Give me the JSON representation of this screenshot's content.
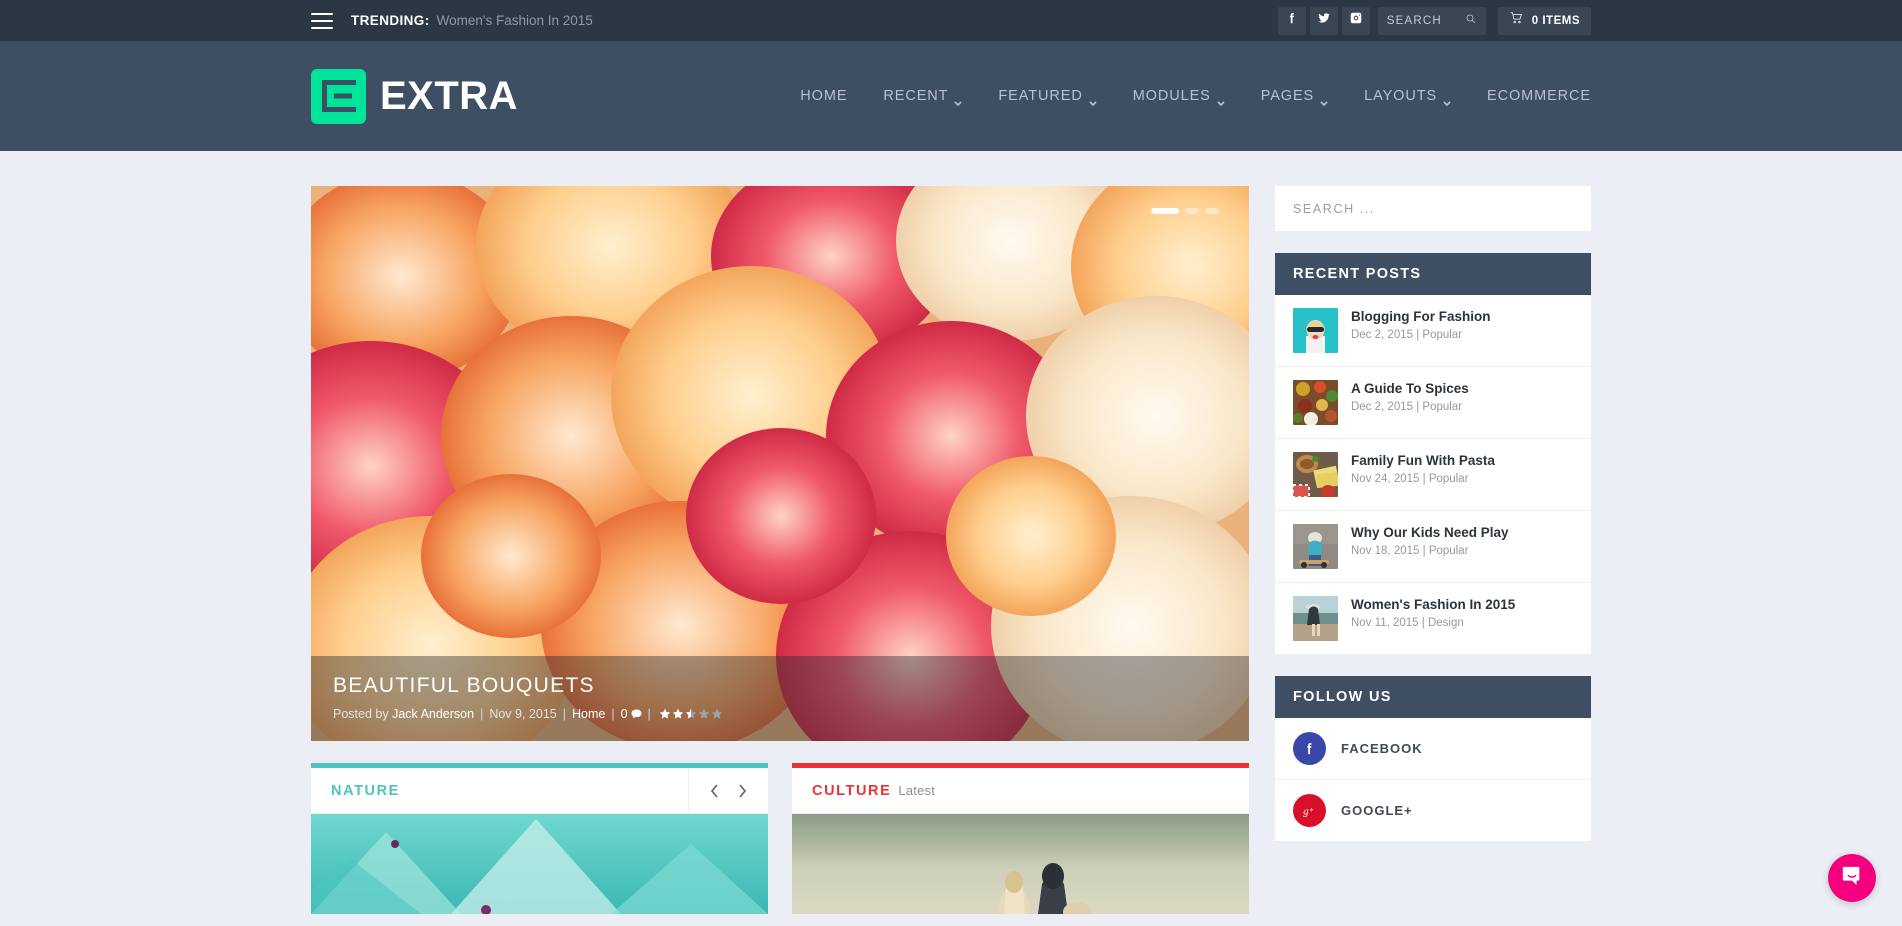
{
  "topbar": {
    "menu_icon": "hamburger-icon",
    "trending_label": "TRENDING:",
    "trending_text": "Women's Fashion In 2015",
    "social": [
      {
        "name": "facebook",
        "icon": "facebook-icon"
      },
      {
        "name": "twitter",
        "icon": "twitter-icon"
      },
      {
        "name": "instagram",
        "icon": "instagram-icon"
      }
    ],
    "search_label": "SEARCH",
    "search_icon": "magnifier-icon",
    "cart_icon": "shopping-cart-icon",
    "cart_label": "0 ITEMS"
  },
  "header": {
    "logo_text": "EXTRA",
    "logo_color": "#00e599",
    "bg_color": "#3e4e63",
    "nav": [
      {
        "label": "HOME",
        "has_dropdown": false
      },
      {
        "label": "RECENT",
        "has_dropdown": true
      },
      {
        "label": "FEATURED",
        "has_dropdown": true
      },
      {
        "label": "MODULES",
        "has_dropdown": true
      },
      {
        "label": "PAGES",
        "has_dropdown": true
      },
      {
        "label": "LAYOUTS",
        "has_dropdown": true
      },
      {
        "label": "ECOMMERCE",
        "has_dropdown": false
      }
    ]
  },
  "slider": {
    "title": "BEAUTIFUL BOUQUETS",
    "posted_by_prefix": "Posted by",
    "author": "Jack Anderson",
    "date": "Nov 9, 2015",
    "category": "Home",
    "comment_count": "0",
    "rating": 2.5,
    "rating_max": 5,
    "dots": 3,
    "active_dot": 1
  },
  "modules": [
    {
      "title": "NATURE",
      "subtitle": "",
      "accent": "#4ec3c0",
      "has_arrows": true,
      "prev_icon": "chevron-left-icon",
      "next_icon": "chevron-right-icon"
    },
    {
      "title": "CULTURE",
      "subtitle": "Latest",
      "accent": "#ec3237",
      "has_arrows": false
    }
  ],
  "sidebar": {
    "search_placeholder": "SEARCH ...",
    "recent_posts": {
      "heading": "RECENT POSTS",
      "items": [
        {
          "title": "Blogging For Fashion",
          "date": "Dec 2, 2015",
          "category": "Popular",
          "thumb": "fashion-sunglasses"
        },
        {
          "title": "A Guide To Spices",
          "date": "Dec 2, 2015",
          "category": "Popular",
          "thumb": "spices-bowls"
        },
        {
          "title": "Family Fun With Pasta",
          "date": "Nov 24, 2015",
          "category": "Popular",
          "thumb": "pasta-table"
        },
        {
          "title": "Why Our Kids Need Play",
          "date": "Nov 18, 2015",
          "category": "Popular",
          "thumb": "kid-skateboard"
        },
        {
          "title": "Women's Fashion In 2015",
          "date": "Nov 11, 2015",
          "category": "Design",
          "thumb": "woman-dock"
        }
      ]
    },
    "follow_us": {
      "heading": "FOLLOW US",
      "items": [
        {
          "label": "FACEBOOK",
          "icon": "facebook-icon",
          "color": "#3b47a8"
        },
        {
          "label": "GOOGLE+",
          "icon": "google-plus-icon",
          "color": "#d8102a"
        }
      ]
    }
  },
  "chat": {
    "icon": "chat-bubble-icon",
    "color": "#f4007f"
  }
}
